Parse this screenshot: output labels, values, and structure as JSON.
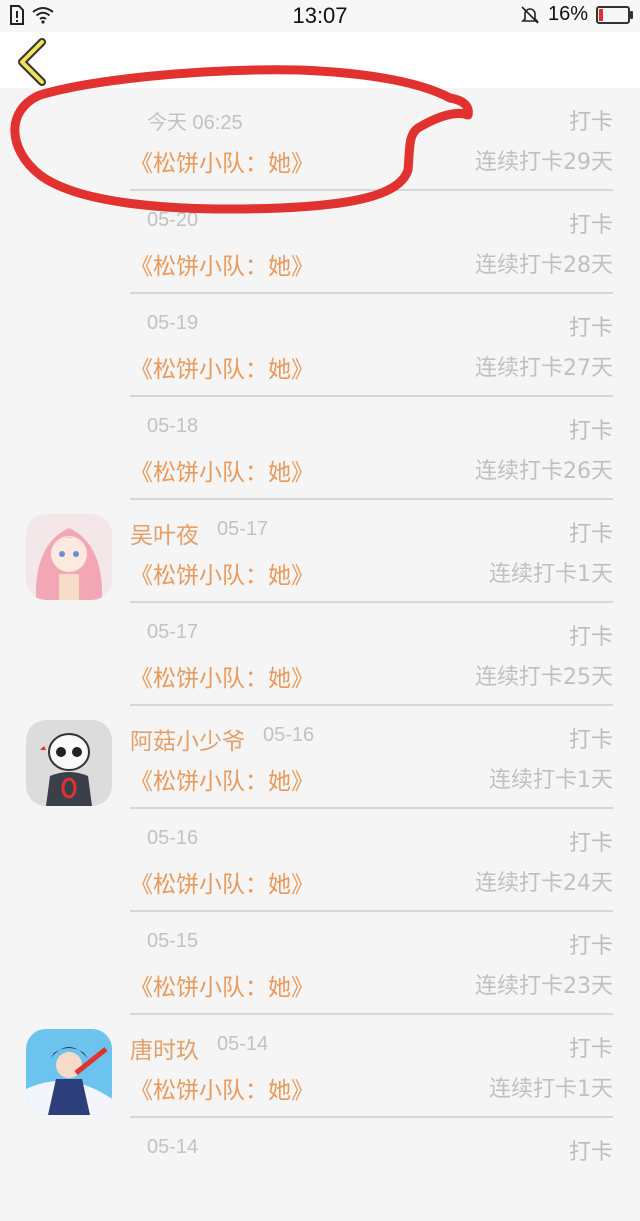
{
  "status_bar": {
    "time": "13:07",
    "battery": "16%",
    "battery_level": 0.16
  },
  "items": [
    {
      "nickname": "",
      "date": "今天 06:25",
      "type": "打卡",
      "title": "《松饼小队：她》",
      "streak": "连续打卡29天",
      "avatar": null
    },
    {
      "nickname": "",
      "date": "05-20",
      "type": "打卡",
      "title": "《松饼小队：她》",
      "streak": "连续打卡28天",
      "avatar": null
    },
    {
      "nickname": "",
      "date": "05-19",
      "type": "打卡",
      "title": "《松饼小队：她》",
      "streak": "连续打卡27天",
      "avatar": null
    },
    {
      "nickname": "",
      "date": "05-18",
      "type": "打卡",
      "title": "《松饼小队：她》",
      "streak": "连续打卡26天",
      "avatar": null
    },
    {
      "nickname": "吴叶夜",
      "date": "05-17",
      "type": "打卡",
      "title": "《松饼小队：她》",
      "streak": "连续打卡1天",
      "avatar": "anime-girl-avatar"
    },
    {
      "nickname": "",
      "date": "05-17",
      "type": "打卡",
      "title": "《松饼小队：她》",
      "streak": "连续打卡25天",
      "avatar": null
    },
    {
      "nickname": "阿菇小少爷",
      "date": "05-16",
      "type": "打卡",
      "title": "《松饼小队：她》",
      "streak": "连续打卡1天",
      "avatar": "skeleton-avatar"
    },
    {
      "nickname": "",
      "date": "05-16",
      "type": "打卡",
      "title": "《松饼小队：她》",
      "streak": "连续打卡24天",
      "avatar": null
    },
    {
      "nickname": "",
      "date": "05-15",
      "type": "打卡",
      "title": "《松饼小队：她》",
      "streak": "连续打卡23天",
      "avatar": null
    },
    {
      "nickname": "唐时玖",
      "date": "05-14",
      "type": "打卡",
      "title": "《松饼小队：她》",
      "streak": "连续打卡1天",
      "avatar": "anime-boy-avatar"
    },
    {
      "nickname": "",
      "date": "05-14",
      "type": "打卡",
      "title": "",
      "streak": "",
      "avatar": null
    }
  ]
}
